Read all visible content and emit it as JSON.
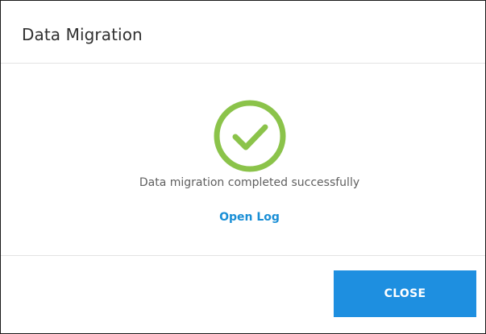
{
  "dialog": {
    "title": "Data Migration"
  },
  "status": {
    "icon": "check-circle-icon",
    "color": "#8bc34a",
    "message": "Data migration completed successfully"
  },
  "links": {
    "open_log": "Open Log",
    "color": "#1a8fd6"
  },
  "footer": {
    "close_label": "CLOSE",
    "button_color": "#1e8fe0"
  }
}
